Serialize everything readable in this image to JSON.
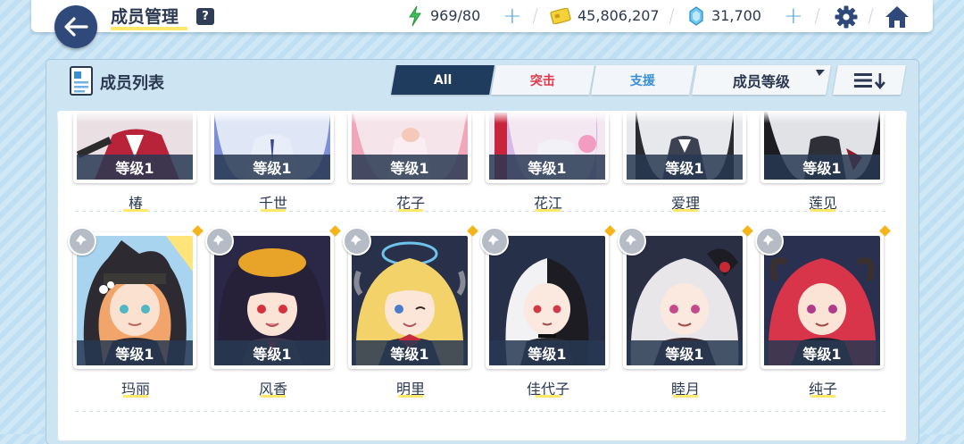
{
  "header": {
    "title": "成员管理",
    "help_label": "?",
    "ap": "969/80",
    "credits": "45,806,207",
    "pyroxene": "31,700"
  },
  "panel": {
    "title": "成员列表",
    "tabs": [
      {
        "label": "All",
        "active": true
      },
      {
        "label": "突击",
        "color": "#e0394b"
      },
      {
        "label": "支援",
        "color": "#3a8fd4"
      }
    ],
    "sort_label": "成员等级"
  },
  "colors": {
    "accent_navy": "#1f3b5e",
    "highlight_yellow": "#ffe86a",
    "new_badge": "#f5b51a"
  },
  "students_row1": [
    {
      "name": "椿",
      "level": "等级1"
    },
    {
      "name": "千世",
      "level": "等级1"
    },
    {
      "name": "花子",
      "level": "等级1"
    },
    {
      "name": "花江",
      "level": "等级1"
    },
    {
      "name": "爱理",
      "level": "等级1"
    },
    {
      "name": "莲见",
      "level": "等级1"
    }
  ],
  "students_row2": [
    {
      "name": "玛丽",
      "level": "等级1"
    },
    {
      "name": "风香",
      "level": "等级1"
    },
    {
      "name": "明里",
      "level": "等级1"
    },
    {
      "name": "佳代子",
      "level": "等级1"
    },
    {
      "name": "睦月",
      "level": "等级1"
    },
    {
      "name": "纯子",
      "level": "等级1"
    }
  ]
}
